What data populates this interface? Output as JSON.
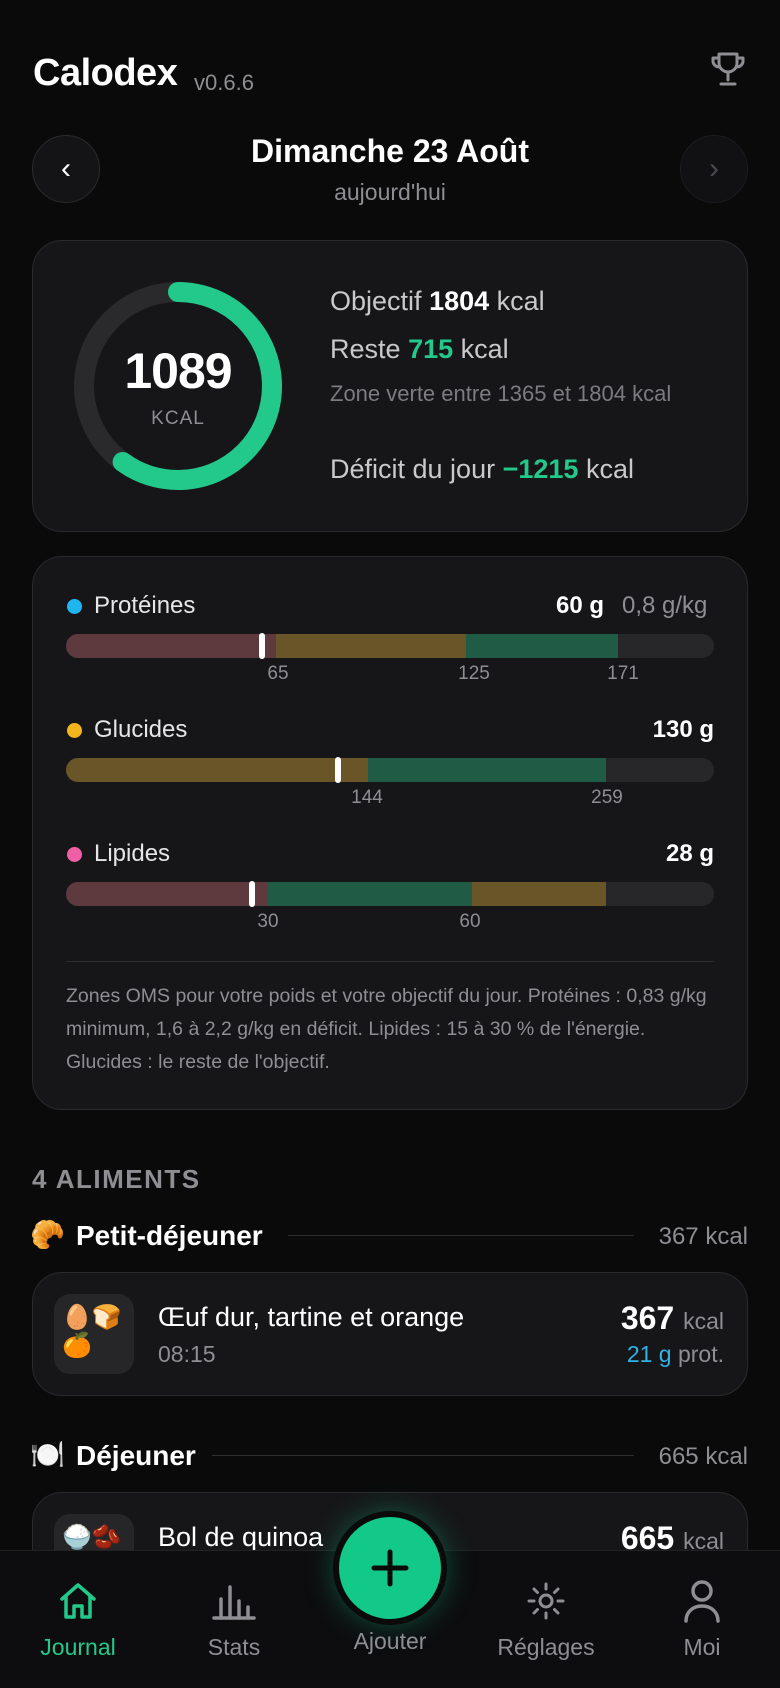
{
  "header": {
    "app_name": "Calodex",
    "version": "v0.6.6",
    "trophy_icon": "trophy-icon"
  },
  "date_nav": {
    "prev_label": "‹",
    "next_label": "›",
    "title": "Dimanche 23 Août",
    "subtitle": "aujourd'hui"
  },
  "summary": {
    "consumed": "1089",
    "consumed_unit": "KCAL",
    "ring_progress": 0.6,
    "objective_label": "Objectif",
    "objective_value": "1804",
    "rest_label": "Reste",
    "rest_value": "715",
    "kcal": "kcal",
    "zone_text": "Zone verte entre 1365 et 1804 kcal",
    "deficit_label": "Déficit du jour",
    "deficit_value": "−1215",
    "accent_color": "#22c98b"
  },
  "macros": [
    {
      "name": "Protéines",
      "color": "#1fb5ee",
      "value": "60 g",
      "per_kg": "0,8 g/kg",
      "ticks": [
        "65",
        "125",
        "171"
      ]
    },
    {
      "name": "Glucides",
      "color": "#f2b51c",
      "value": "130 g",
      "ticks": [
        "144",
        "259"
      ]
    },
    {
      "name": "Lipides",
      "color": "#ef5fa6",
      "value": "28 g",
      "ticks": [
        "30",
        "60"
      ]
    }
  ],
  "macro_note": "Zones OMS pour votre poids et votre objectif du jour. Protéines : 0,83 g/kg minimum, 1,6 à 2,2 g/kg en déficit. Lipides : 15 à 30 % de l'énergie. Glucides : le reste de l'objectif.",
  "food_list": {
    "count_label": "4 ALIMENTS",
    "meals": [
      {
        "emoji": "🥐",
        "name": "Petit-déjeuner",
        "kcal": "367 kcal",
        "items": [
          {
            "emoji": "🥚🍞🍊",
            "name": "Œuf dur, tartine et orange",
            "time": "08:15",
            "kcal": "367",
            "kcal_unit": "kcal",
            "prot": "21 g",
            "prot_unit": "prot."
          }
        ]
      },
      {
        "emoji": "🍽️",
        "name": "Déjeuner",
        "kcal": "665 kcal",
        "items": [
          {
            "emoji": "🍚🫘",
            "name": "Bol de quinoa",
            "kcal": "665",
            "kcal_unit": "kcal"
          }
        ]
      }
    ]
  },
  "tabbar": {
    "tabs": [
      {
        "label": "Journal",
        "icon": "home-icon",
        "active": true
      },
      {
        "label": "Stats",
        "icon": "bar-chart-icon"
      },
      {
        "label": "Ajouter",
        "icon": "plus-icon"
      },
      {
        "label": "Réglages",
        "icon": "gear-icon"
      },
      {
        "label": "Moi",
        "icon": "user-icon"
      }
    ]
  }
}
